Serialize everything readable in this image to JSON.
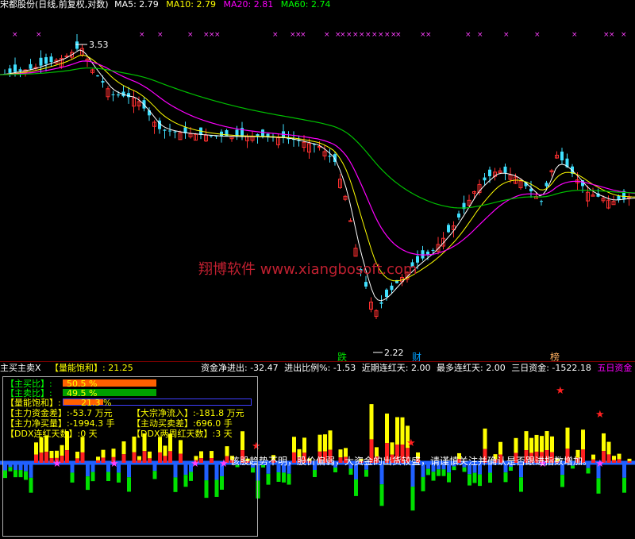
{
  "header": {
    "title": "宋都股份(日线,前复权,对数)",
    "indicators": [
      {
        "label": "MA5: 2.79",
        "color": "#ffffff"
      },
      {
        "label": "MA10: 2.79",
        "color": "#ffff00"
      },
      {
        "label": "MA20: 2.81",
        "color": "#ff00ff"
      },
      {
        "label": "MA60: 2.74",
        "color": "#00ff00"
      }
    ]
  },
  "main_chart": {
    "high_label": "3.53",
    "low_label": "2.22",
    "watermark": "翔博软件 www.xiangbosoft.com",
    "markers": {
      "die": "跌",
      "cai": "财",
      "bang": "榜"
    }
  },
  "sub_header": {
    "name": "主买主卖X",
    "saturation_label": "【量能饱和】:",
    "saturation_value": "21.25",
    "capital_flow": "资金净进出: -32.47",
    "in_out_ratio": "进出比例%: -1.53",
    "recent_red_days": "近期连红天: 2.00",
    "max_red_days": "最多连红天: 2.00",
    "three_day_funds": "三日资金: -1522.18",
    "five_day_funds": "五日资金"
  },
  "panel": {
    "buy_ratio_label": "【主买比】:",
    "buy_ratio_value": "50.5  %",
    "sell_ratio_label": "【主卖比】:",
    "sell_ratio_value": "49.5  %",
    "saturation_label": "【量能饱和】:",
    "saturation_value": "21.3  %",
    "net_diff_label": "【主力资金差】",
    "net_diff_value": ":-53.7 万元",
    "block_inflow_label": "【大宗净流入】",
    "block_inflow_value": ":-181.8 万元",
    "net_buy_vol_label": "【主力净买量】",
    "net_buy_vol_value": ":-1994.3 手",
    "active_diff_label": "【主动买卖差】",
    "active_diff_value": ":696.0 手",
    "ddx_label": "【DDX连红天数】",
    "ddx_value": ":0 天",
    "ddx_two_week_label": "【DDX两周红天数】",
    "ddx_two_week_value": ":3 天",
    "buy_ratio": 0.505,
    "sell_ratio": 0.495,
    "saturation": 0.213
  },
  "ticker": {
    "text": "该股趋势不明，股价偏弱，大资金的出货较盛，请谨慎关注并确认是否跟进指数增加。"
  }
}
